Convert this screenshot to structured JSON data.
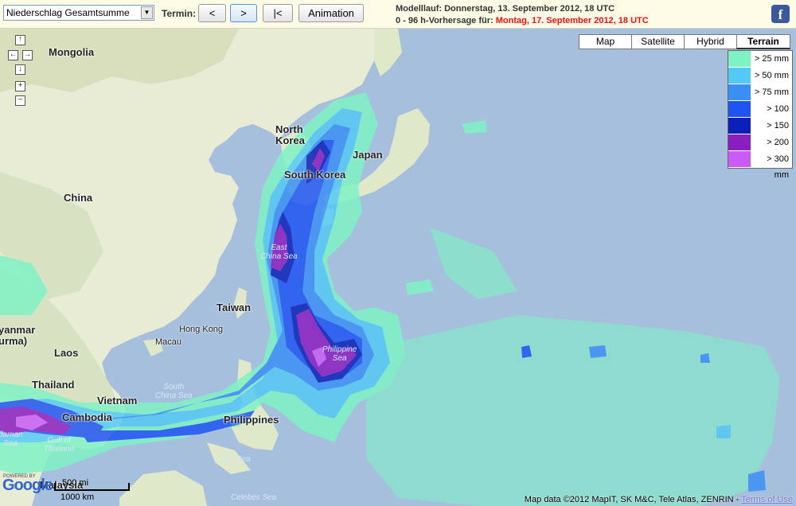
{
  "toolbar": {
    "select_value": "Niederschlag Gesamtsumme",
    "termin_label": "Termin:",
    "prev_label": "<",
    "next_label": ">",
    "first_label": "|<",
    "animation_label": "Animation",
    "model_run": "Modelllauf: Donnerstag, 13. September 2012, 18 UTC",
    "forecast_prefix": "0 - 96 h-Vorhersage für:",
    "forecast_date": "Montag, 17. September 2012, 18 UTC",
    "facebook_icon": "facebook-icon"
  },
  "map_types": [
    "Map",
    "Satellite",
    "Hybrid",
    "Terrain"
  ],
  "map_type_selected": "Terrain",
  "legend": [
    {
      "label": "> 25 mm",
      "color": "#7ff2c4"
    },
    {
      "label": "> 50 mm",
      "color": "#55c9f5"
    },
    {
      "label": "> 75 mm",
      "color": "#3a8ff5"
    },
    {
      "label": "> 100 mm",
      "color": "#1f54f2"
    },
    {
      "label": "> 150 mm",
      "color": "#0a20b8"
    },
    {
      "label": "> 200 mm",
      "color": "#8a1ec0"
    },
    {
      "label": "> 300 mm",
      "color": "#c85cf5"
    }
  ],
  "places": {
    "mongolia": "Mongolia",
    "china": "China",
    "north_korea": "North\nKorea",
    "south_korea": "South Korea",
    "japan": "Japan",
    "taiwan": "Taiwan",
    "hong_kong": "Hong Kong",
    "macau": "Macau",
    "laos": "Laos",
    "thailand": "Thailand",
    "vietnam": "Vietnam",
    "cambodia": "Cambodia",
    "philippines": "Philippines",
    "myanmar": "yanmar\nurma)",
    "malaysia": "Malaysia"
  },
  "seas": {
    "east_china_sea": "East\nChina Sea",
    "philippine_sea": "Philippine\nSea",
    "south_china_sea": "South\nChina Sea",
    "gulf_thailand": "Gulf of\nThailand",
    "andaman_sea": "daman\nSea",
    "sulu_sea": "Sulu Sea",
    "celebes_sea": "Celebes Sea"
  },
  "scale": {
    "miles": "500 mi",
    "km": "1000 km"
  },
  "google": {
    "powered_by": "POWERED BY",
    "logo": "Google"
  },
  "copyright": {
    "text": "Map data ©2012 MapIT, SK M&C, Tele Atlas, ZENRIN -",
    "terms": "Terms of Use"
  },
  "nav_icons": [
    "pan-up-icon",
    "pan-left-icon",
    "pan-right-icon",
    "pan-down-icon",
    "zoom-in-icon",
    "zoom-out-icon"
  ]
}
